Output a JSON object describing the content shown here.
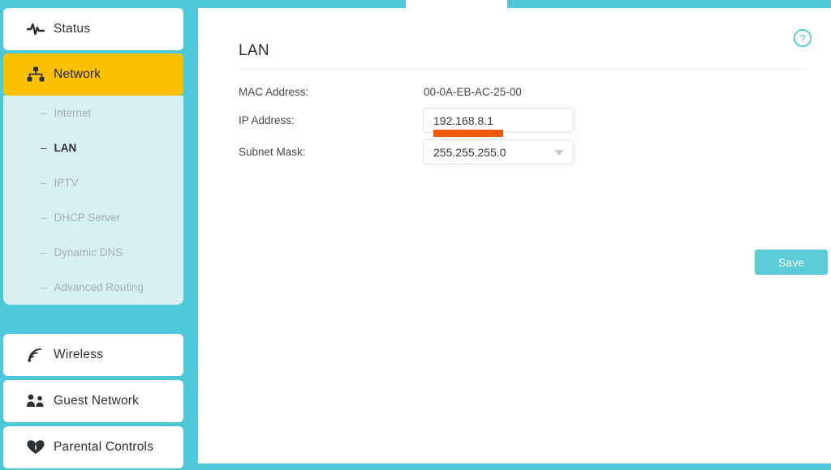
{
  "theme": {
    "accent_teal": "#4ec8d8",
    "active_yellow": "#fcc200",
    "submenu_bg": "#d9f0f2",
    "highlight_orange": "#f05a0c",
    "save_button": "#5bcbd8"
  },
  "sidebar": {
    "items": [
      {
        "label": "Status",
        "icon": "pulse-icon",
        "active": false
      },
      {
        "label": "Network",
        "icon": "sitemap-icon",
        "active": true
      },
      {
        "label": "Wireless",
        "icon": "wifi-icon",
        "active": false
      },
      {
        "label": "Guest Network",
        "icon": "users-icon",
        "active": false
      },
      {
        "label": "Parental Controls",
        "icon": "heart-shield-icon",
        "active": false
      }
    ],
    "submenu": [
      {
        "label": "Internet",
        "active": false
      },
      {
        "label": "LAN",
        "active": true
      },
      {
        "label": "IPTV",
        "active": false
      },
      {
        "label": "DHCP Server",
        "active": false
      },
      {
        "label": "Dynamic DNS",
        "active": false
      },
      {
        "label": "Advanced Routing",
        "active": false
      }
    ],
    "submenu_dash": "–"
  },
  "main": {
    "title": "LAN",
    "help_icon": "question-circle-icon",
    "fields": {
      "mac_label": "MAC Address:",
      "mac_value": "00-0A-EB-AC-25-00",
      "ip_label": "IP Address:",
      "ip_value": "192.168.8.1",
      "subnet_label": "Subnet Mask:",
      "subnet_value": "255.255.255.0"
    },
    "save_label": "Save"
  }
}
